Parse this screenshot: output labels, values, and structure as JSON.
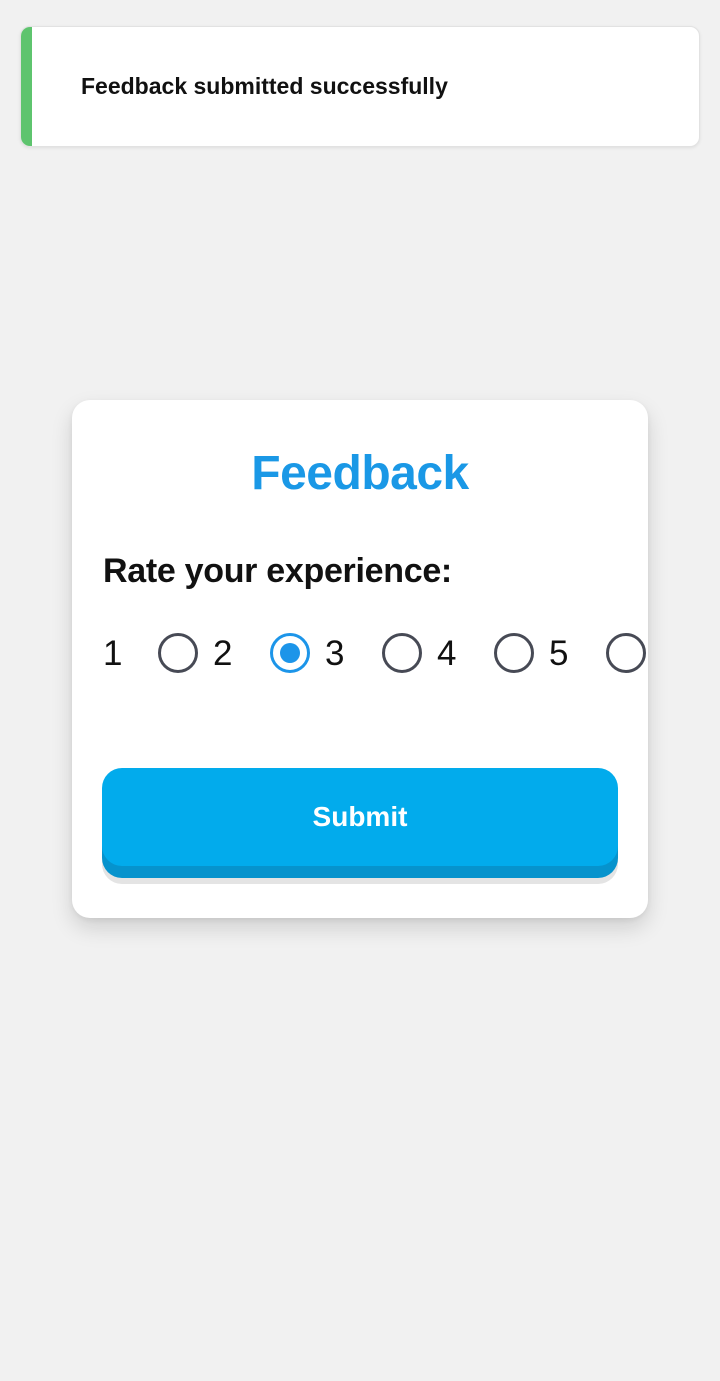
{
  "toast": {
    "message": "Feedback submitted successfully",
    "accent_color": "#5ec46e"
  },
  "card": {
    "title": "Feedback",
    "rate_label": "Rate your experience:",
    "rating": {
      "options": [
        "1",
        "2",
        "3",
        "4",
        "5"
      ],
      "selected": "2"
    },
    "submit_label": "Submit"
  },
  "colors": {
    "title": "#1a98e6",
    "button": "#02abec",
    "radio_checked": "#1c95e9",
    "background": "#f1f1f1"
  }
}
